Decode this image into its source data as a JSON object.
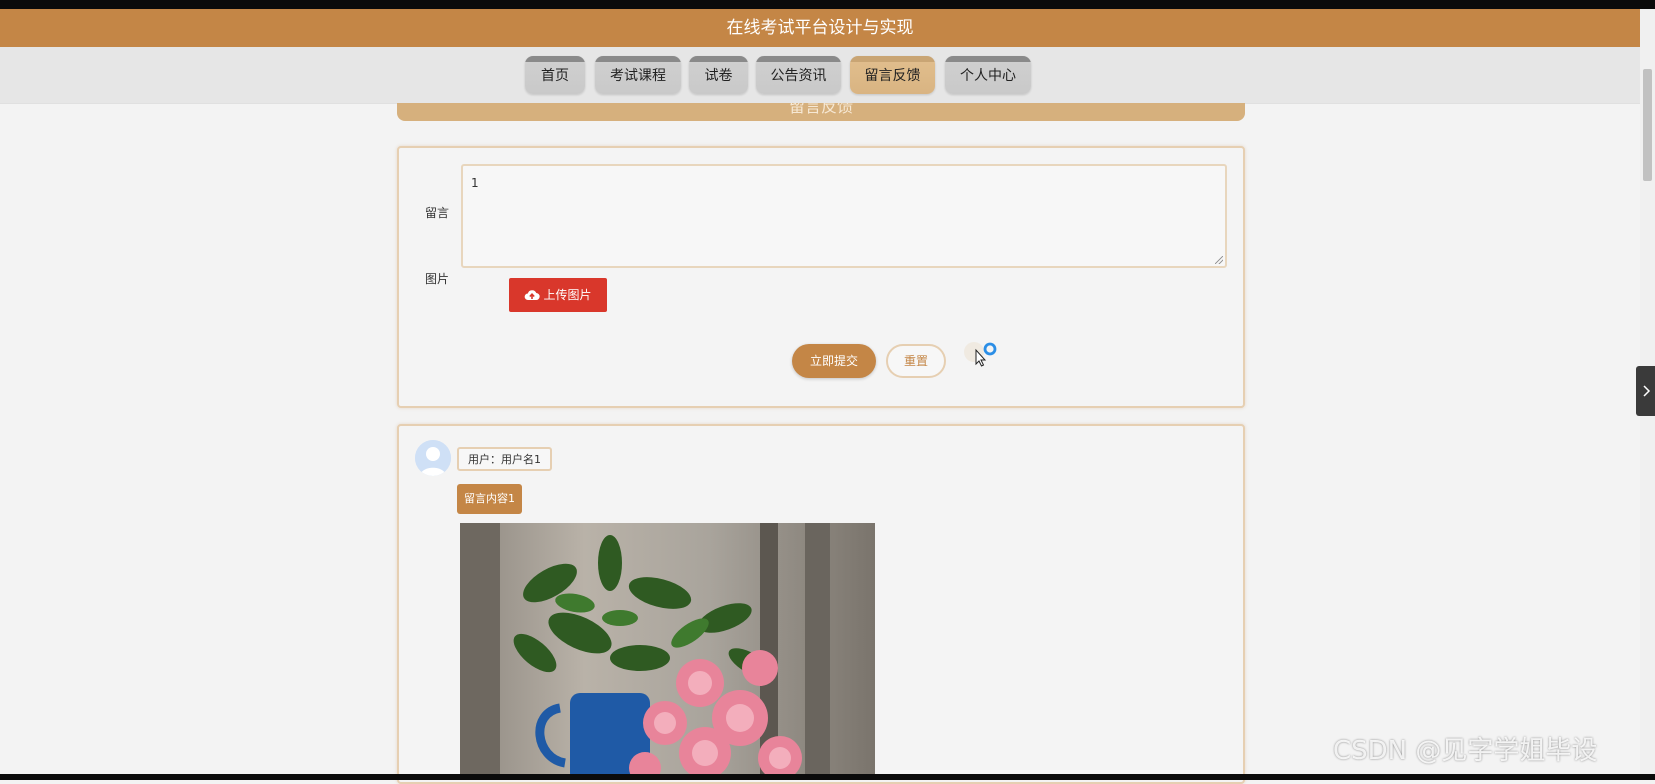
{
  "header": {
    "title": "在线考试平台设计与实现"
  },
  "nav": {
    "items": [
      "首页",
      "考试课程",
      "试卷",
      "公告资讯",
      "留言反馈",
      "个人中心"
    ],
    "active": "留言反馈"
  },
  "section": {
    "title": "留言反馈"
  },
  "form": {
    "message_label": "留言",
    "message_value": "1",
    "image_label": "图片",
    "upload_label": "上传图片",
    "submit_label": "立即提交",
    "reset_label": "重置"
  },
  "messages": [
    {
      "user": "用户：用户名1",
      "content": "留言内容1"
    }
  ],
  "watermark": "CSDN @见字学姐毕设",
  "colors": {
    "brand": "#c48646",
    "active_tab": "#e0bd8c",
    "upload": "#d9372b"
  }
}
